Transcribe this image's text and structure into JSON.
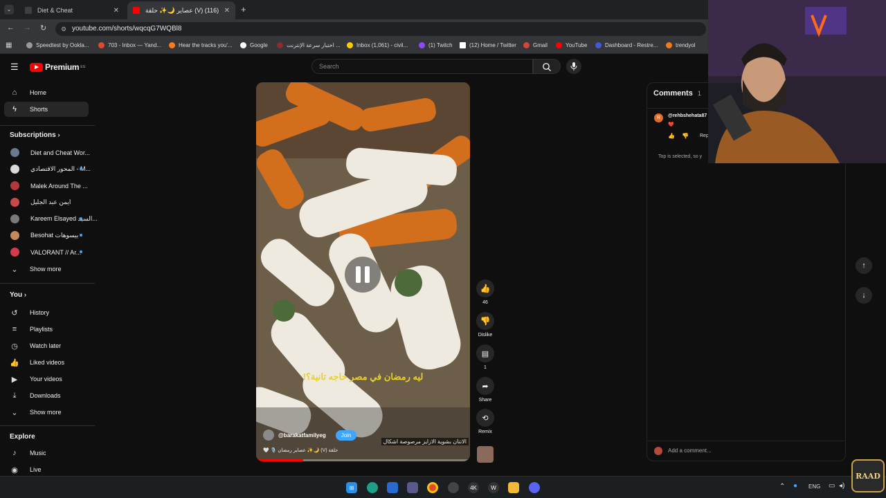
{
  "tabs": [
    {
      "title": "Diet & Cheat",
      "active": false
    },
    {
      "title": "عصاير 🌙✨ حلقة (V) (116)",
      "active": true
    }
  ],
  "address": {
    "url": "youtube.com/shorts/wqcqG7WQBl8"
  },
  "bookmarks": [
    "Speedtest by Ookla...",
    "703 - Inbox — Yand...",
    "Hear the tracks you'...",
    "Google",
    "اختبار سرعة الإنترنت ...",
    "Inbox (1,061) - civil...",
    "(1) Twitch",
    "(12) Home / Twitter",
    "Gmail",
    "YouTube",
    "Dashboard - Restre...",
    "trendyol"
  ],
  "youtube": {
    "logo_text": "Premium",
    "logo_region": "EG",
    "search_placeholder": "Search",
    "nav": {
      "home": "Home",
      "shorts": "Shorts"
    },
    "subscriptions_title": "Subscriptions",
    "subscriptions": [
      {
        "name": "Diet and Cheat Wor...",
        "color": "#6a7a8c",
        "dot": false
      },
      {
        "name": "المحور الاقتصادي - M...",
        "color": "#d9d9d9",
        "dot": true
      },
      {
        "name": "Malek Around The ...",
        "color": "#b03a3a",
        "dot": false
      },
      {
        "name": "ايمن عبد الجليل",
        "color": "#c74a4a",
        "dot": false
      },
      {
        "name": "Kareem Elsayed السيد...",
        "color": "#7a7a7a",
        "dot": true
      },
      {
        "name": "Besohat بيسوهات",
        "color": "#c68a5a",
        "dot": true
      },
      {
        "name": "VALORANT // Ar...",
        "color": "#d33b4a",
        "dot": true
      }
    ],
    "show_more": "Show more",
    "you_title": "You",
    "you_items": [
      "History",
      "Playlists",
      "Watch later",
      "Liked videos",
      "Your videos",
      "Downloads"
    ],
    "show_more_2": "Show more",
    "explore_title": "Explore",
    "explore_items": [
      "Music",
      "Live"
    ]
  },
  "short": {
    "caption": "ليه رمضان في مصر حاجه تانية؟!",
    "channel": "@barakatfamilyeg",
    "join": "Join",
    "title": "حلقة (V) 🌙✨ عصاير رمضان 🎙️ 🤍",
    "subtitle": "الاتنان بشوية الازايز مرصوصة اشكال",
    "likes": "46",
    "dislike_label": "Dislike",
    "comments_count": "1",
    "share_label": "Share",
    "remix_label": "Remix"
  },
  "comments": {
    "title": "Comments",
    "count": "1",
    "user": "@rehbshehata87",
    "heart": "❤️",
    "reply": "Repl",
    "sort_note": "Top is selected, so y",
    "add_placeholder": "Add a comment..."
  },
  "taskbar": {
    "lang": "ENG"
  },
  "watermark": "RAAD"
}
